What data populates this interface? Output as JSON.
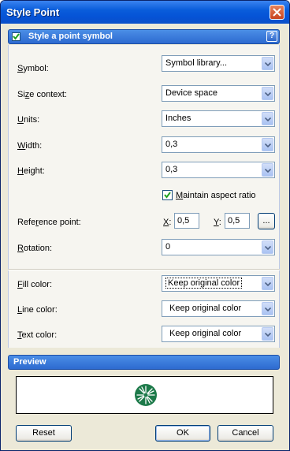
{
  "window": {
    "title": "Style Point"
  },
  "section": {
    "title": "Style a point symbol",
    "checked": true,
    "help_icon": "?"
  },
  "fields": {
    "symbol": {
      "label_u": "S",
      "label_rest": "ymbol:",
      "value": "Symbol library..."
    },
    "size_context": {
      "label_pre": "Si",
      "label_u": "z",
      "label_rest": "e context:",
      "value": "Device space"
    },
    "units": {
      "label_u": "U",
      "label_rest": "nits:",
      "value": "Inches"
    },
    "width": {
      "label_u": "W",
      "label_rest": "idth:",
      "value": "0,3"
    },
    "height": {
      "label_u": "H",
      "label_rest": "eight:",
      "value": "0,3"
    },
    "maintain_aspect": {
      "label_u": "M",
      "label_rest": "aintain aspect ratio",
      "checked": true
    },
    "reference_point": {
      "label_pre": "Refe",
      "label_u": "r",
      "label_rest": "ence point:",
      "x_label_u": "X",
      "x_label_rest": ":",
      "x_value": "0,5",
      "y_label_u": "Y",
      "y_label_rest": ":",
      "y_value": "0,5",
      "browse_label": "..."
    },
    "rotation": {
      "label_u": "R",
      "label_rest": "otation:",
      "value": "0"
    },
    "fill_color": {
      "label_u": "F",
      "label_rest": "ill color:",
      "value": "Keep original color"
    },
    "line_color": {
      "label_u": "L",
      "label_rest": "ine color:",
      "value": "Keep original color"
    },
    "text_color": {
      "label_u": "T",
      "label_rest": "ext color:",
      "value": "Keep original color"
    }
  },
  "preview": {
    "title": "Preview",
    "symbol_icon": "green-starburst-symbol",
    "symbol_color": "#1d7a4a"
  },
  "buttons": {
    "reset": "Reset",
    "ok": "OK",
    "cancel": "Cancel"
  },
  "colors": {
    "title_bar": "#0553d6",
    "section_header": "#2d6ad0",
    "close_button": "#c8431f",
    "check_mark": "#21a121"
  }
}
